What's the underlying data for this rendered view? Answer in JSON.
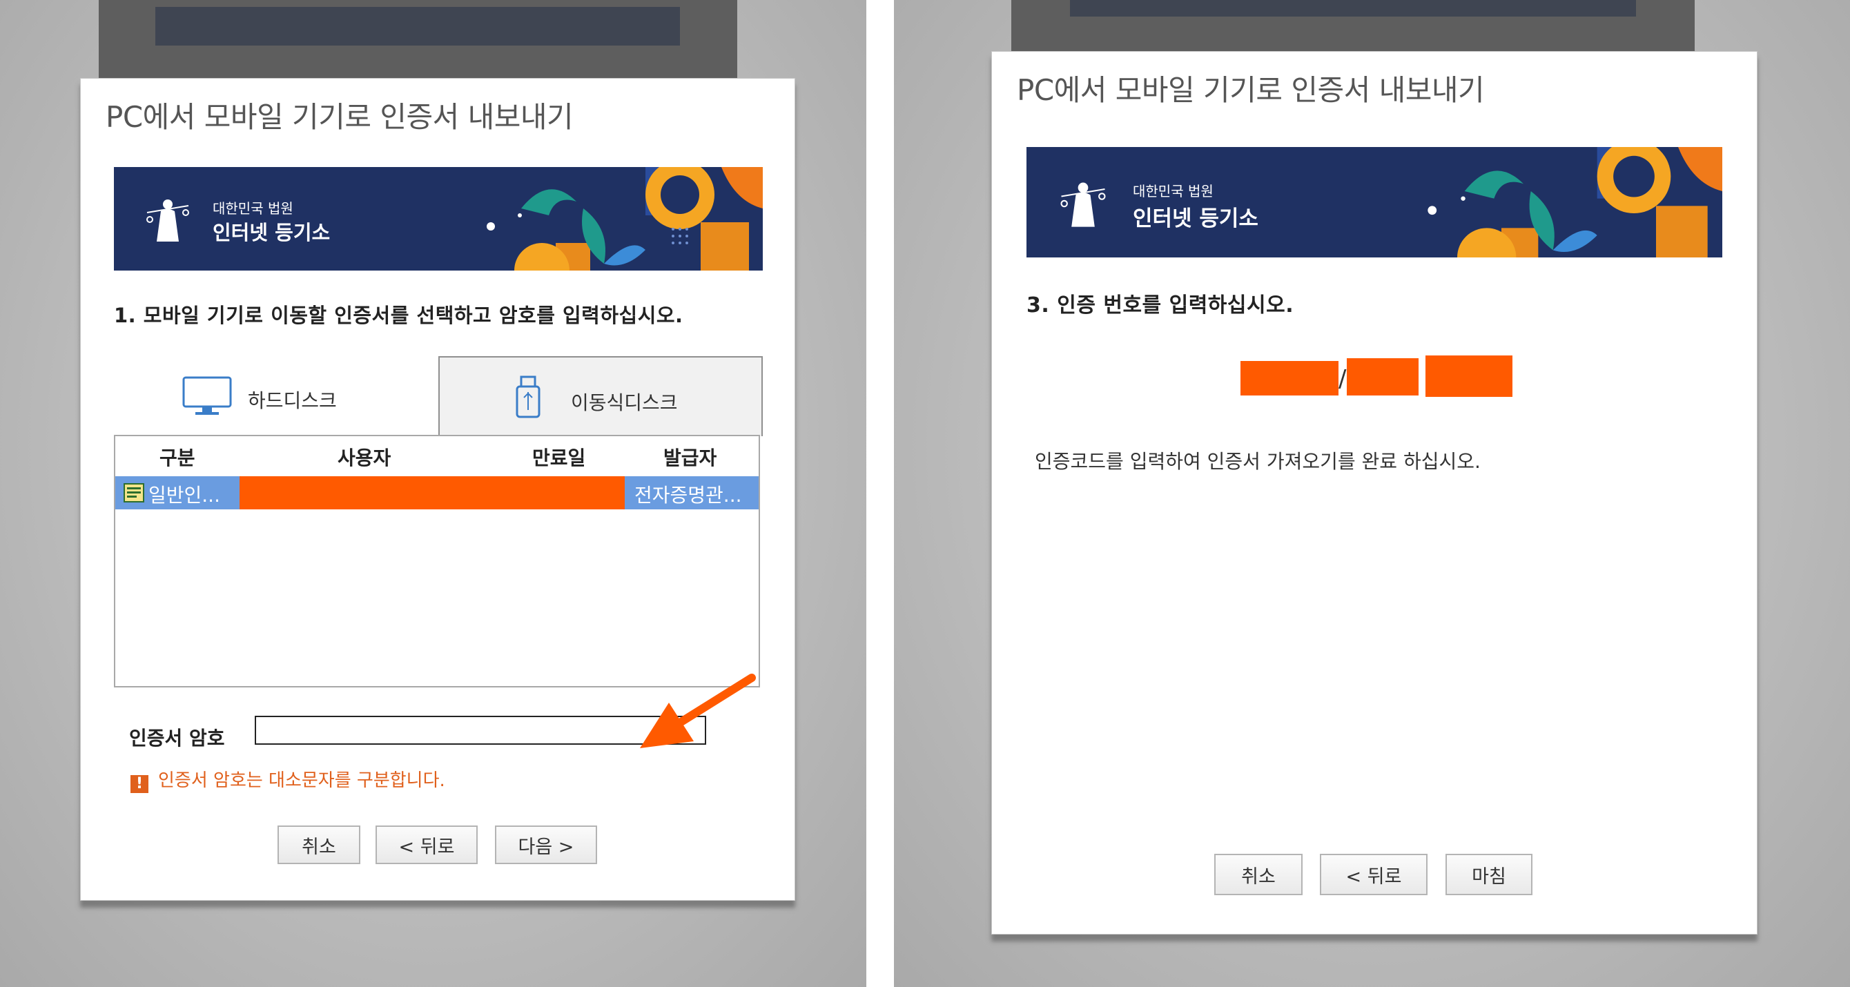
{
  "left_dialog": {
    "title": "PC에서 모바일 기기로 인증서 내보내기",
    "banner": {
      "org": "대한민국 법원",
      "service": "인터넷 등기소"
    },
    "step": "1. 모바일 기기로 이동할 인증서를 선택하고 암호를 입력하십시오.",
    "tabs": [
      {
        "label": "하드디스크",
        "icon": "monitor-icon",
        "selected": false
      },
      {
        "label": "이동식디스크",
        "icon": "usb-icon",
        "selected": true
      }
    ],
    "table": {
      "columns": [
        "구분",
        "사용자",
        "만료일",
        "발급자"
      ],
      "rows": [
        {
          "type": "일반인...",
          "user": "",
          "expiry": "",
          "issuer": "전자증명관..."
        }
      ]
    },
    "password_label": "인증서 암호",
    "password_value": "",
    "warning": "인증서 암호는 대소문자를 구분합니다.",
    "buttons": {
      "cancel": "취소",
      "back": "< 뒤로",
      "next": "다음 >"
    }
  },
  "right_dialog": {
    "title": "PC에서 모바일 기기로 인증서 내보내기",
    "banner": {
      "org": "대한민국 법원",
      "service": "인터넷 등기소"
    },
    "step": "3. 인증 번호를 입력하십시오.",
    "message": "인증코드를 입력하여 인증서 가져오기를 완료 하십시오.",
    "buttons": {
      "cancel": "취소",
      "back": "< 뒤로",
      "finish": "마침"
    }
  },
  "colors": {
    "redaction": "#ff5a00",
    "banner": "#1f3163",
    "selection": "#6a9ce0",
    "warning": "#e0601c",
    "annotation_arrow": "#ff5a00"
  }
}
